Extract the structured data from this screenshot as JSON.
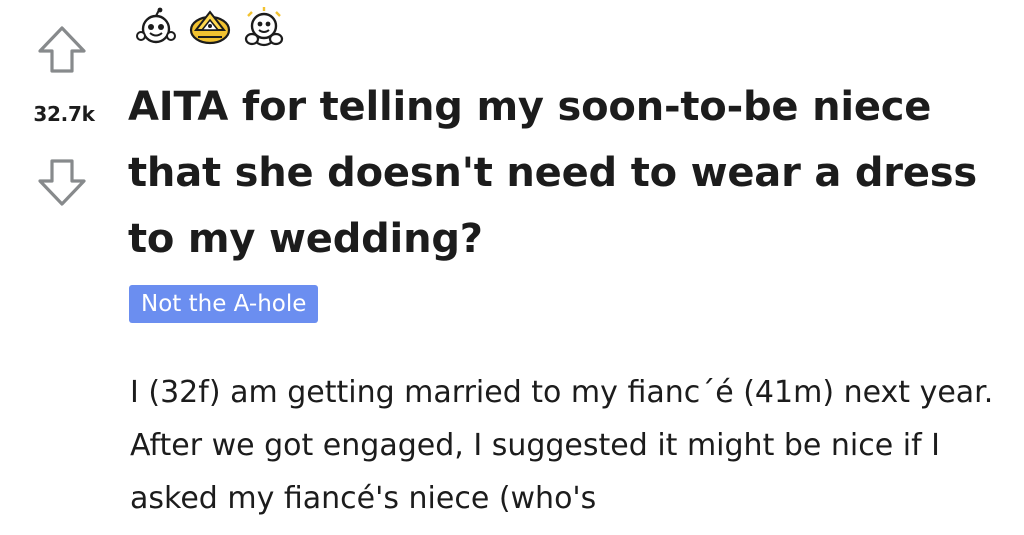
{
  "post": {
    "score": "32.7k",
    "title": "AITA for telling my soon-to-be niece that she doesn't need to wear a dress to my wedding?",
    "flair": "Not the A-hole",
    "body": "I (32f) am getting married to my fianc´é (41m) next year. After we got engaged, I suggested it might be nice if I asked my fiancé's niece (who's",
    "awards": [
      "wholesome-award-icon",
      "helpful-award-icon",
      "hugz-award-icon"
    ],
    "colors": {
      "text": "#1c1c1c",
      "flair_background": "#6b8ef0",
      "flair_text": "#ffffff",
      "arrow": "#878a8c"
    }
  }
}
